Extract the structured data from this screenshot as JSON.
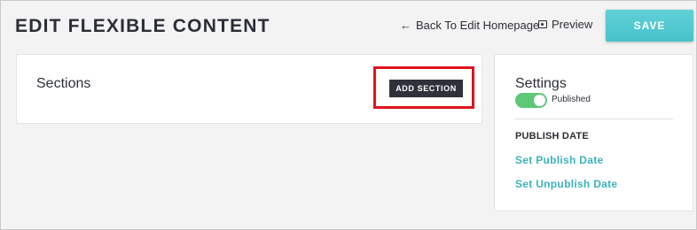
{
  "header": {
    "title": "EDIT FLEXIBLE CONTENT",
    "back_arrow": "←",
    "back_label": "Back To Edit Homepage",
    "preview_label": "Preview",
    "save_label": "SAVE"
  },
  "sections": {
    "title": "Sections",
    "add_button_label": "ADD SECTION"
  },
  "settings": {
    "title": "Settings",
    "status_label": "Published",
    "status_on": true,
    "publish_heading": "PUBLISH DATE",
    "set_publish_label": "Set Publish Date",
    "set_unpublish_label": "Set Unpublish Date"
  },
  "colors": {
    "accent": "#48c3cb",
    "toggle_on": "#5cc878",
    "highlight": "#e0141d",
    "dark_button": "#2f323a"
  },
  "icons": {
    "back": "arrow-left-icon",
    "preview": "preview-icon"
  }
}
